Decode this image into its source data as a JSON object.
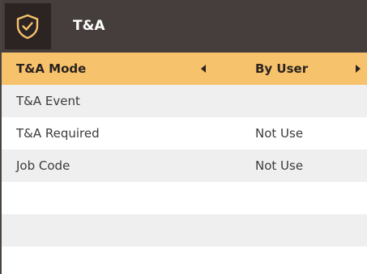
{
  "header": {
    "title": "T&A",
    "icon": "shield-check-icon"
  },
  "settings": [
    {
      "label": "T&A Mode",
      "value": "By User",
      "selected": true
    },
    {
      "label": "T&A Event",
      "value": ""
    },
    {
      "label": "T&A Required",
      "value": "Not Use"
    },
    {
      "label": "Job Code",
      "value": "Not Use"
    }
  ],
  "colors": {
    "header_bg": "#463e3c",
    "icon_box_bg": "#2b2423",
    "accent": "#f7c26c",
    "row_shade": "#f0efef"
  }
}
